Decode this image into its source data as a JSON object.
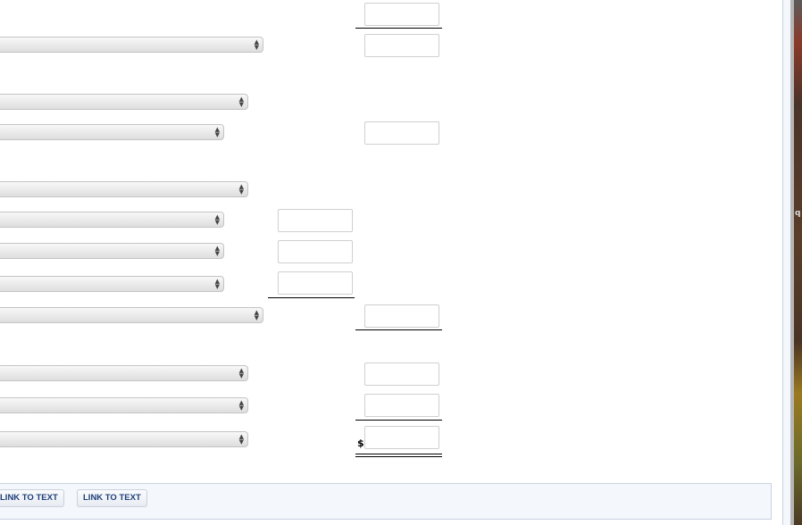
{
  "footer": {
    "buttons": [
      {
        "label": "LINK TO TEXT"
      },
      {
        "label": "LINK TO TEXT"
      }
    ]
  },
  "currency_symbol": "$",
  "desktop_text": "q",
  "colors": {
    "link_text": "#1f3f7a",
    "footer_bg": "#f4f7fb"
  }
}
